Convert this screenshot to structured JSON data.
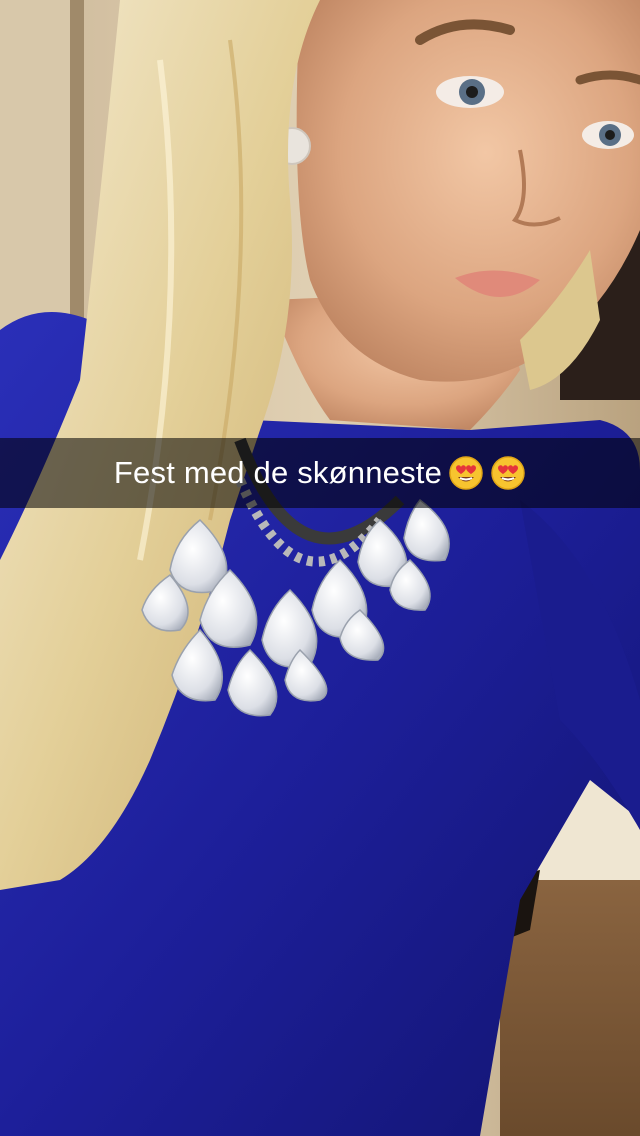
{
  "snap": {
    "caption": "Fest med de skønneste",
    "caption_emojis": [
      "heart-eyes-emoji",
      "heart-eyes-emoji"
    ]
  },
  "colors": {
    "caption_bar": "#000000",
    "caption_text": "#ffffff",
    "dress_blue": "#1d1f9a",
    "hair_blonde": "#e8d9a8"
  }
}
